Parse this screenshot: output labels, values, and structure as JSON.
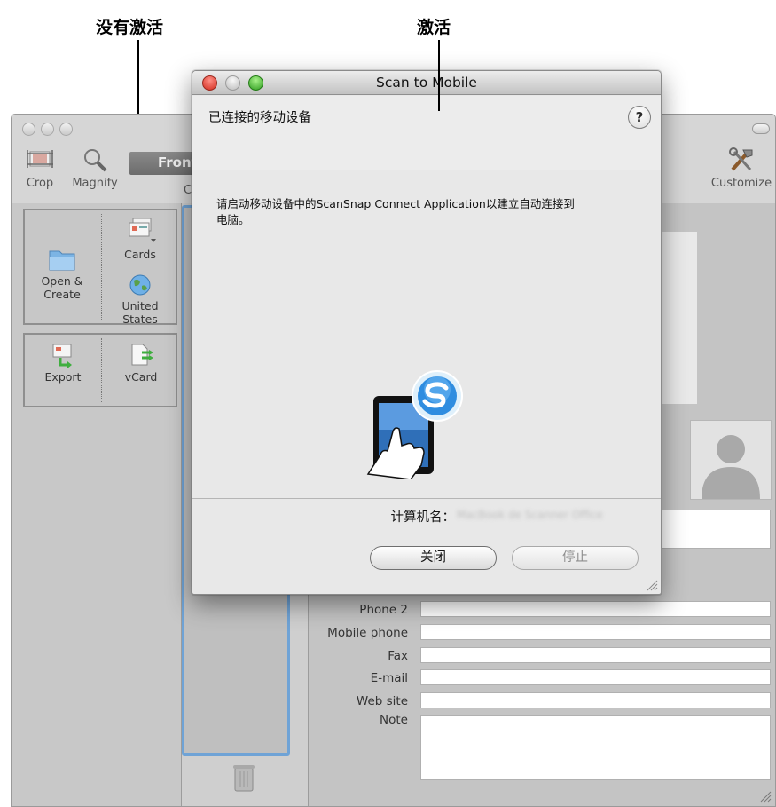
{
  "annotations": {
    "inactive": "没有激活",
    "active": "激活"
  },
  "back_window": {
    "toolbar": {
      "crop": "Crop",
      "magnify": "Magnify",
      "front_tab": "Front",
      "partial_label": "C",
      "customize": "Customize"
    },
    "left_panel": {
      "cards": "Cards",
      "open_create": "Open &",
      "open_create_2": "Create",
      "region": "United States",
      "export": "Export",
      "vcard": "vCard"
    },
    "fields": {
      "phone2": "Phone 2",
      "mobile_phone": "Mobile phone",
      "fax": "Fax",
      "email": "E-mail",
      "web_site": "Web site",
      "note": "Note"
    }
  },
  "dialog": {
    "title": "Scan to Mobile",
    "heading": "已连接的移动设备",
    "help_label": "?",
    "message_line1": "请启动移动设备中的ScanSnap Connect Application以建立自动连接到",
    "message_line2": "电脑。",
    "computer_name_label": "计算机名：",
    "computer_name_value": "MacBook de Scanner Office",
    "close_button": "关闭",
    "stop_button": "停止"
  },
  "colors": {
    "close_red": "#d22d1f",
    "zoom_green": "#2f9d20",
    "scansnap_blue": "#2f8de0",
    "selection_blue": "#6fa3d6"
  }
}
